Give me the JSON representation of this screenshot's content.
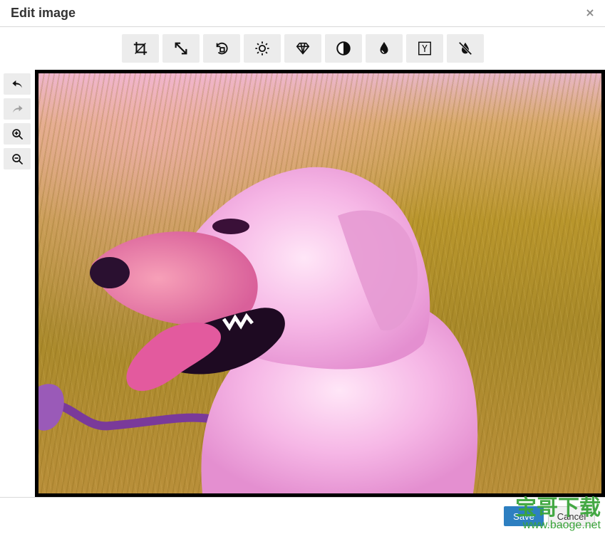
{
  "dialog": {
    "title": "Edit image",
    "close_label": "×"
  },
  "toolbar": {
    "tools": [
      {
        "icon": "crop-icon"
      },
      {
        "icon": "resize-icon"
      },
      {
        "icon": "rotate-icon"
      },
      {
        "icon": "brightness-icon"
      },
      {
        "icon": "sharpen-icon"
      },
      {
        "icon": "contrast-icon"
      },
      {
        "icon": "color-levels-icon"
      },
      {
        "icon": "gamma-icon"
      },
      {
        "icon": "invert-icon"
      }
    ],
    "gamma_glyph": "Y"
  },
  "side_tools": [
    {
      "icon": "undo-icon",
      "enabled": true
    },
    {
      "icon": "redo-icon",
      "enabled": false
    },
    {
      "icon": "zoom-in-icon",
      "enabled": true
    },
    {
      "icon": "zoom-out-icon",
      "enabled": true
    }
  ],
  "image": {
    "subject": "dog-photo"
  },
  "footer": {
    "save_label": "Save",
    "cancel_label": "Cancel"
  },
  "watermark": {
    "text_cn": "宝哥下载",
    "url": "www.baoge.net"
  },
  "colors": {
    "accent": "#2d7fc1",
    "button_bg": "#ececec",
    "frame": "#000000",
    "watermark": "#3aa53a"
  }
}
